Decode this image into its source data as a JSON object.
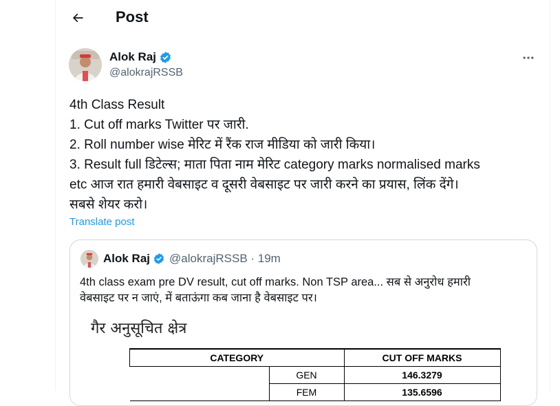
{
  "header": {
    "title": "Post",
    "back_icon": "arrow-left-icon"
  },
  "post": {
    "author_name": "Alok Raj",
    "author_handle": "@alokrajRSSB",
    "verified_color": "#1d9bf0",
    "lines": [
      "4th Class Result",
      "1. Cut off marks Twitter पर जारी.",
      "2. Roll number wise मेरिट में रैंक राज मीडिया को जारी किया।",
      "3. Result full डिटेल्स; माता पिता नाम मेरिट category marks normalised marks",
      "etc आज रात हमारी वेबसाइट व दूसरी वेबसाइट पर जारी करने का प्रयास, लिंक देंगे।",
      "सबसे शेयर करो।"
    ],
    "translate_label": "Translate post"
  },
  "quote": {
    "author_name": "Alok Raj",
    "author_handle": "@alokrajRSSB · 19m",
    "lines": [
      "4th class exam pre DV result, cut off marks. Non TSP area... सब से अनुरोध हमारी",
      "वेबसाइट पर न जाएं, में बताऊंगा कब जाना है वेबसाइट पर।"
    ],
    "image": {
      "heading": "गैर अनुसूचित क्षेत्र",
      "table": {
        "headers": [
          "CATEGORY",
          "CUT OFF MARKS"
        ],
        "rows": [
          {
            "sub": "GEN",
            "value": "146.3279"
          },
          {
            "sub": "FEM",
            "value": "135.6596"
          }
        ]
      }
    }
  }
}
